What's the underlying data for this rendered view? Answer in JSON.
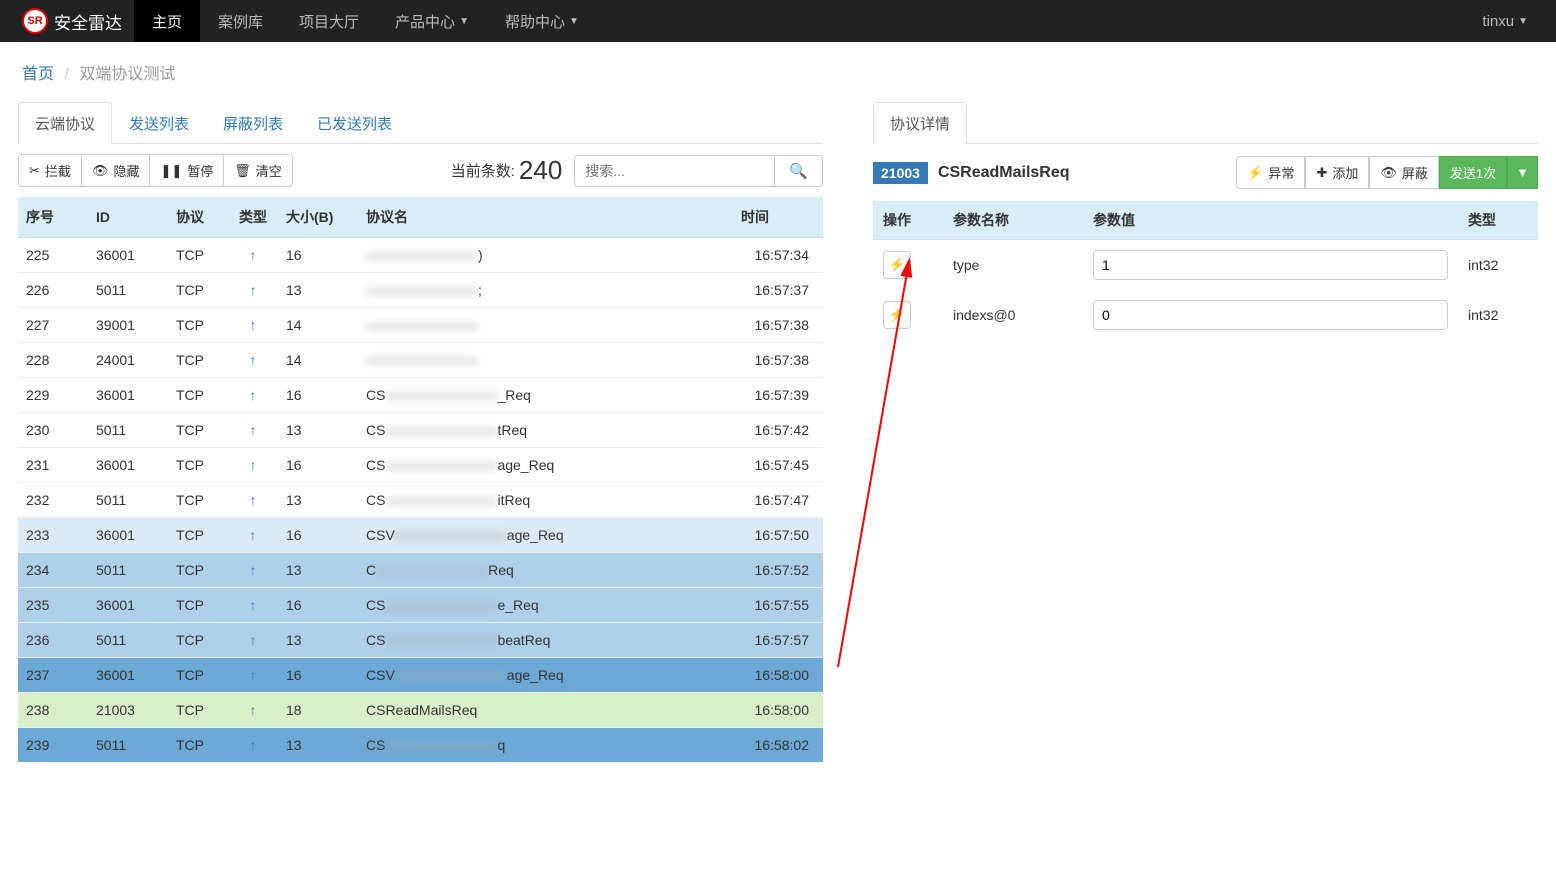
{
  "nav": {
    "brand": "安全雷达",
    "logo_text": "SR",
    "items": [
      "主页",
      "案例库",
      "项目大厅",
      "产品中心",
      "帮助中心"
    ],
    "dropdown_indices": [
      3,
      4
    ],
    "active_index": 0,
    "user": "tinxu"
  },
  "breadcrumb": {
    "home": "首页",
    "current": "双端协议测试"
  },
  "left": {
    "tabs": [
      "云端协议",
      "发送列表",
      "屏蔽列表",
      "已发送列表"
    ],
    "active_tab": 0,
    "toolbar": {
      "intercept": "拦截",
      "hide": "隐藏",
      "pause": "暂停",
      "clear": "清空",
      "count_label": "当前条数:",
      "count_value": "240",
      "search_placeholder": "搜索..."
    },
    "columns": {
      "seq": "序号",
      "id": "ID",
      "proto": "协议",
      "type": "类型",
      "size": "大小(B)",
      "name": "协议名",
      "time": "时间"
    },
    "rows": [
      {
        "seq": "225",
        "id": "36001",
        "proto": "TCP",
        "size": "16",
        "name_prefix": "",
        "name_suffix": ")",
        "time": "16:57:34",
        "masked": true,
        "shade": ""
      },
      {
        "seq": "226",
        "id": "5011",
        "proto": "TCP",
        "size": "13",
        "name_prefix": "",
        "name_suffix": ";",
        "time": "16:57:37",
        "masked": true,
        "shade": ""
      },
      {
        "seq": "227",
        "id": "39001",
        "proto": "TCP",
        "size": "14",
        "name_prefix": "",
        "name_suffix": "",
        "time": "16:57:38",
        "masked": true,
        "shade": ""
      },
      {
        "seq": "228",
        "id": "24001",
        "proto": "TCP",
        "size": "14",
        "name_prefix": "",
        "name_suffix": "",
        "time": "16:57:38",
        "masked": true,
        "shade": ""
      },
      {
        "seq": "229",
        "id": "36001",
        "proto": "TCP",
        "size": "16",
        "name_prefix": "CS",
        "name_suffix": "_Req",
        "time": "16:57:39",
        "masked": true,
        "shade": ""
      },
      {
        "seq": "230",
        "id": "5011",
        "proto": "TCP",
        "size": "13",
        "name_prefix": "CS",
        "name_suffix": "tReq",
        "time": "16:57:42",
        "masked": true,
        "shade": ""
      },
      {
        "seq": "231",
        "id": "36001",
        "proto": "TCP",
        "size": "16",
        "name_prefix": "CS",
        "name_suffix": "age_Req",
        "time": "16:57:45",
        "masked": true,
        "shade": ""
      },
      {
        "seq": "232",
        "id": "5011",
        "proto": "TCP",
        "size": "13",
        "name_prefix": "CS",
        "name_suffix": "itReq",
        "time": "16:57:47",
        "masked": true,
        "shade": ""
      },
      {
        "seq": "233",
        "id": "36001",
        "proto": "TCP",
        "size": "16",
        "name_prefix": "CSV",
        "name_suffix": "age_Req",
        "time": "16:57:50",
        "masked": true,
        "shade": "row-shade-1"
      },
      {
        "seq": "234",
        "id": "5011",
        "proto": "TCP",
        "size": "13",
        "name_prefix": "C",
        "name_suffix": "Req",
        "time": "16:57:52",
        "masked": true,
        "shade": "row-shade-2"
      },
      {
        "seq": "235",
        "id": "36001",
        "proto": "TCP",
        "size": "16",
        "name_prefix": "CS",
        "name_suffix": "e_Req",
        "time": "16:57:55",
        "masked": true,
        "shade": "row-shade-2"
      },
      {
        "seq": "236",
        "id": "5011",
        "proto": "TCP",
        "size": "13",
        "name_prefix": "CS",
        "name_suffix": "beatReq",
        "time": "16:57:57",
        "masked": true,
        "shade": "row-shade-2"
      },
      {
        "seq": "237",
        "id": "36001",
        "proto": "TCP",
        "size": "16",
        "name_prefix": "CSV",
        "name_suffix": "age_Req",
        "time": "16:58:00",
        "masked": true,
        "shade": "row-shade-3"
      },
      {
        "seq": "238",
        "id": "21003",
        "proto": "TCP",
        "size": "18",
        "name_prefix": "CSReadMailsReq",
        "name_suffix": "",
        "time": "16:58:00",
        "masked": false,
        "shade": "row-green"
      },
      {
        "seq": "239",
        "id": "5011",
        "proto": "TCP",
        "size": "13",
        "name_prefix": "CS",
        "name_suffix": "q",
        "time": "16:58:02",
        "masked": true,
        "shade": "row-shade-3"
      }
    ]
  },
  "right": {
    "tab": "协议详情",
    "badge": "21003",
    "title": "CSReadMailsReq",
    "buttons": {
      "exception": "异常",
      "add": "添加",
      "mask": "屏蔽",
      "send": "发送1次"
    },
    "columns": {
      "op": "操作",
      "pname": "参数名称",
      "pval": "参数值",
      "ptype": "类型"
    },
    "params": [
      {
        "name": "type",
        "value": "1",
        "type": "int32"
      },
      {
        "name": "indexs@0",
        "value": "0",
        "type": "int32"
      }
    ]
  }
}
